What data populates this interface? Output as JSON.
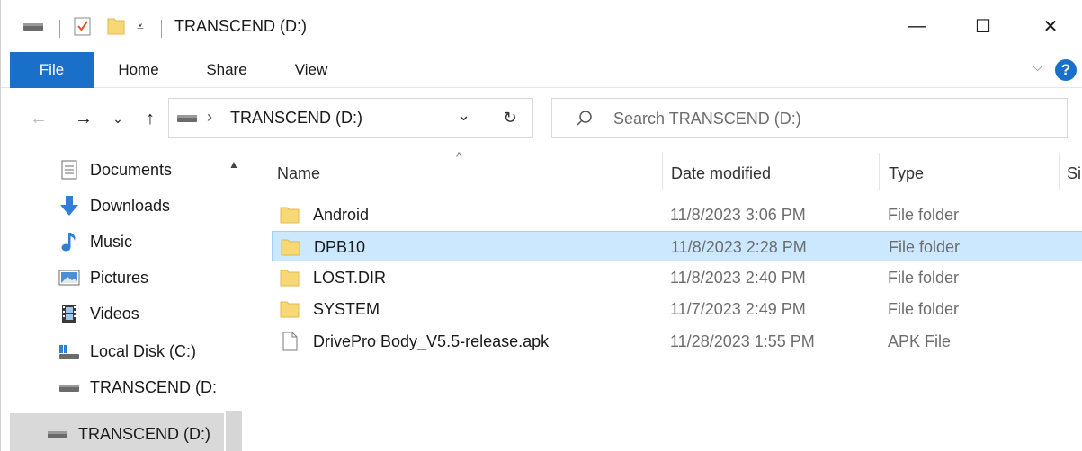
{
  "window": {
    "title": "TRANSCEND (D:)",
    "controls": {
      "minimize": "—",
      "maximize": "☐",
      "close": "✕"
    }
  },
  "ribbon": {
    "tabs": [
      "File",
      "Home",
      "Share",
      "View"
    ],
    "help": "?",
    "expand_chevron": "⌵"
  },
  "nav": {
    "back": "←",
    "forward": "→",
    "recent": "⌄",
    "up": "↑",
    "breadcrumb_sep": "›",
    "address": "TRANSCEND (D:)",
    "address_dropdown": "⌄",
    "refresh": "↻",
    "search_placeholder": "Search TRANSCEND (D:)"
  },
  "navpane": {
    "items": [
      {
        "label": "Documents",
        "icon": "documents-icon"
      },
      {
        "label": "Downloads",
        "icon": "downloads-icon"
      },
      {
        "label": "Music",
        "icon": "music-icon"
      },
      {
        "label": "Pictures",
        "icon": "pictures-icon"
      },
      {
        "label": "Videos",
        "icon": "videos-icon"
      },
      {
        "label": "Local Disk (C:)",
        "icon": "local-disk-icon"
      },
      {
        "label": "TRANSCEND (D:",
        "icon": "drive-icon"
      },
      {
        "label": "TRANSCEND (D:)",
        "icon": "drive-icon",
        "selected": true
      }
    ],
    "scroll_up": "▲"
  },
  "columns": {
    "name": "Name",
    "date": "Date modified",
    "type": "Type",
    "size": "Si",
    "sort_indicator": "^"
  },
  "files": [
    {
      "name": "Android",
      "date": "11/8/2023 3:06 PM",
      "type": "File folder",
      "kind": "folder"
    },
    {
      "name": "DPB10",
      "date": "11/8/2023 2:28 PM",
      "type": "File folder",
      "kind": "folder",
      "selected": true
    },
    {
      "name": "LOST.DIR",
      "date": "11/8/2023 2:40 PM",
      "type": "File folder",
      "kind": "folder"
    },
    {
      "name": "SYSTEM",
      "date": "11/7/2023 2:49 PM",
      "type": "File folder",
      "kind": "folder"
    },
    {
      "name": "DrivePro Body_V5.5-release.apk",
      "date": "11/28/2023 1:55 PM",
      "type": "APK File",
      "kind": "file"
    }
  ],
  "colors": {
    "accent": "#1a6fc9",
    "selection": "#cce8ff",
    "selection_border": "#99d1ff",
    "folder": "#f8d775"
  }
}
